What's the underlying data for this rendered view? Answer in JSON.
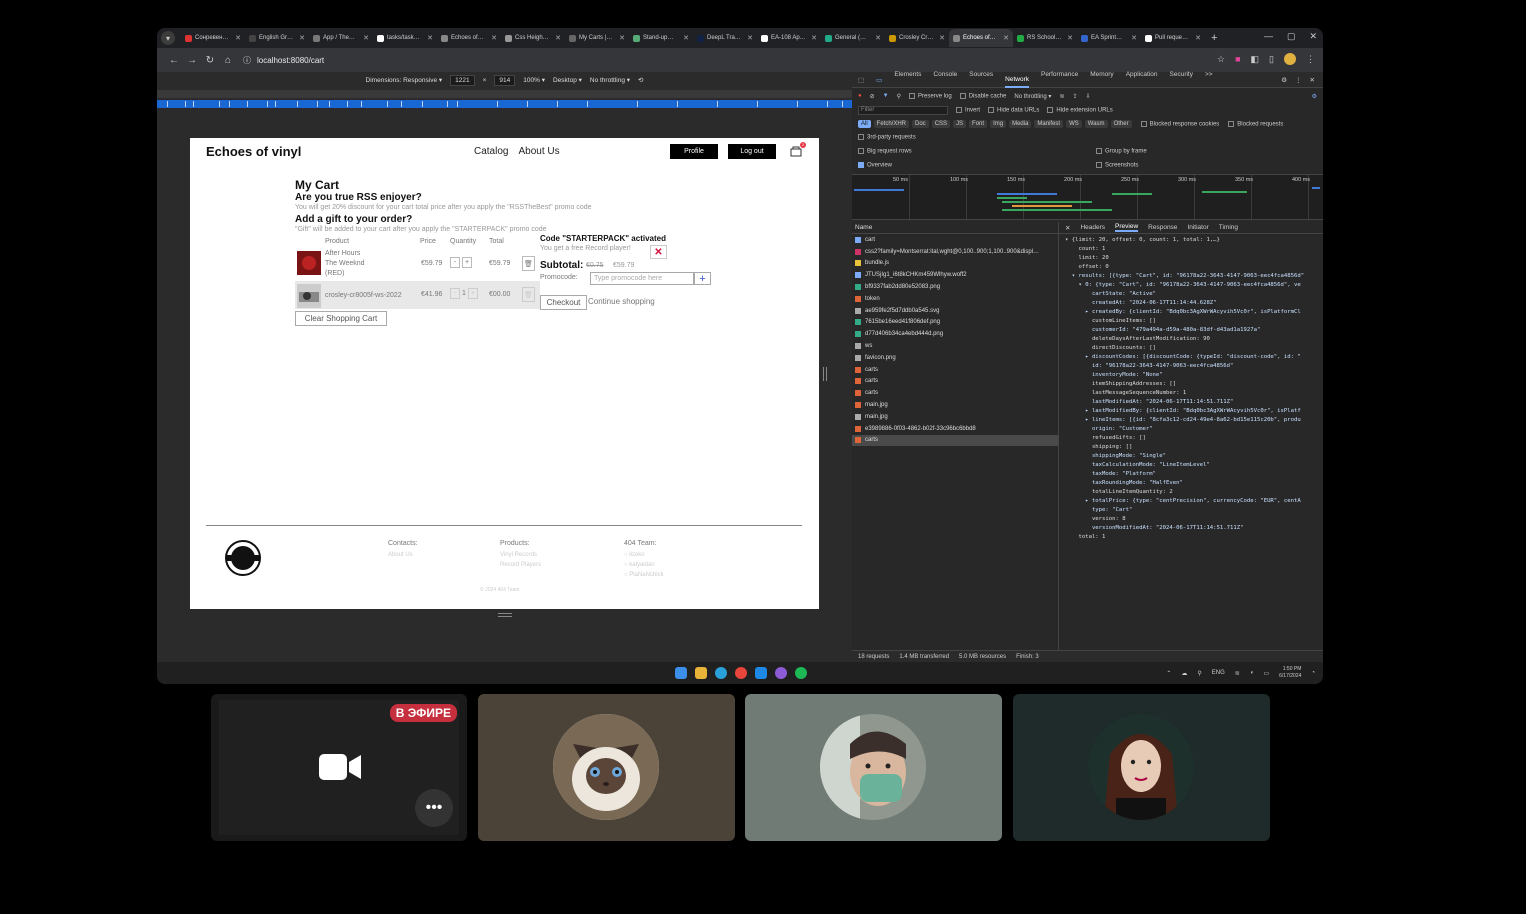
{
  "browser": {
    "tabs": [
      {
        "label": "Coнpeвен…",
        "color": "#d33"
      },
      {
        "label": "English Gr…",
        "color": "#444"
      },
      {
        "label": "App / The…",
        "color": "#777"
      },
      {
        "label": "tasks/task…",
        "color": "#fff"
      },
      {
        "label": "Echoes of…",
        "color": "#888"
      },
      {
        "label": "Css Heigh…",
        "color": "#999"
      },
      {
        "label": "My Carts |…",
        "color": "#666"
      },
      {
        "label": "Stand-up…",
        "color": "#5a7"
      },
      {
        "label": "DeepL Tra…",
        "color": "#124"
      },
      {
        "label": "EA-108 Ap…",
        "color": "#fff"
      },
      {
        "label": "General (…",
        "color": "#2a8"
      },
      {
        "label": "Crosley Cr…",
        "color": "#c90"
      },
      {
        "label": "Echoes of…",
        "color": "#888",
        "active": true
      },
      {
        "label": "RS School…",
        "color": "#2a4"
      },
      {
        "label": "EA Sprint…",
        "color": "#36c"
      },
      {
        "label": "Pull reque…",
        "color": "#fff"
      }
    ],
    "url": "localhost:8080/cart",
    "device": {
      "dimensions_label": "Dimensions: Responsive ▾",
      "width": "1221",
      "x": "×",
      "height": "914",
      "zoom": "100% ▾",
      "mode": "Desktop ▾",
      "throttle": "No throttling ▾"
    }
  },
  "site": {
    "logo": "Echoes of vinyl",
    "nav": [
      "Catalog",
      "About Us"
    ],
    "profile_btn": "Profile",
    "logout_btn": "Log out",
    "cart_count": "2",
    "cart_title": "My Cart",
    "rss_heading": "Are you true RSS enjoyer?",
    "rss_text": "You will get 20% discount for your cart total price after you apply the \"RSSTheBest\" promo code",
    "gift_heading": "Add a gift to your order?",
    "gift_text": "\"Gift\" will be added to your cart after you apply the \"STARTERPACK\" promo code",
    "columns": [
      "Product",
      "Price",
      "Quantity",
      "Total"
    ],
    "items": [
      {
        "name_lines": [
          "After Hours",
          "The Weeknd",
          "(RED)"
        ],
        "price": "€59.79",
        "qty": "1",
        "total": "€59.79"
      },
      {
        "name_lines": [
          "crosley-cr8005f-ws-2022"
        ],
        "price": "€41.96",
        "qty": "1",
        "total": "€00.00"
      }
    ],
    "code_activated": "Code \"STARTERPACK\" activated",
    "free_record": "You get a free Record player!",
    "subtotal_label": "Subtotal:",
    "old_price": "€0.75",
    "new_price": "€59.79",
    "promo_label": "Promocode:",
    "promo_placeholder": "Type promocode here",
    "checkout": "Checkout",
    "continue": "Continue shopping",
    "clear": "Clear Shopping Cart",
    "footer": {
      "contacts": "Contacts:",
      "contacts_links": [
        "About Us"
      ],
      "products": "Products:",
      "products_links": [
        "Vinyl Records",
        "Record Players"
      ],
      "team": "404 Team:",
      "team_links": [
        "lizeko",
        "kalyaidan",
        "PlaNaNchick"
      ],
      "copy": "© 2024 404 Team"
    }
  },
  "devtools": {
    "tabs": [
      "Elements",
      "Console",
      "Sources",
      "Network",
      "Performance",
      "Memory",
      "Application",
      "Security",
      ">>"
    ],
    "active_tab": "Network",
    "toolbar": {
      "preserve": "Preserve log",
      "disable_cache": "Disable cache",
      "throttle": "No throttling"
    },
    "filter_placeholder": "Filter",
    "filter_opts": [
      "Invert",
      "Hide data URLs",
      "Hide extension URLs"
    ],
    "types": [
      "All",
      "Fetch/XHR",
      "Doc",
      "CSS",
      "JS",
      "Font",
      "Img",
      "Media",
      "Manifest",
      "WS",
      "Wasm",
      "Other"
    ],
    "blocked": [
      "Blocked response cookies",
      "Blocked requests"
    ],
    "third_party": "3rd-party requests",
    "big_rows": "Big request rows",
    "group_frame": "Group by frame",
    "overview": "Overview",
    "screenshots": "Screenshots",
    "timeline_labels": [
      "50 ms",
      "100 ms",
      "150 ms",
      "200 ms",
      "250 ms",
      "300 ms",
      "350 ms",
      "400 ms"
    ],
    "name_header": "Name",
    "requests": [
      {
        "name": "cart",
        "color": "#7cacf8"
      },
      {
        "name": "css2?family=Montserrat:ital,wght@0,100..900;1,100..900&displ…",
        "color": "#c36"
      },
      {
        "name": "bundle.js",
        "color": "#e8c23a"
      },
      {
        "name": "JTUSjIg1_i6t8kCHKm459Wlhyw.woff2",
        "color": "#7cacf8"
      },
      {
        "name": "bf9337fab2dd80e52083.png",
        "color": "#3a8"
      },
      {
        "name": "token",
        "color": "#e0643a"
      },
      {
        "name": "ae959fe2f5d7ddb0a545.svg",
        "color": "#aaa"
      },
      {
        "name": "7615be16eed41f806def.png",
        "color": "#3a8"
      },
      {
        "name": "d77d406b34ca4ebd444d.png",
        "color": "#3a8"
      },
      {
        "name": "ws",
        "color": "#aaa"
      },
      {
        "name": "favicon.png",
        "color": "#aaa"
      },
      {
        "name": "carts",
        "color": "#e0643a"
      },
      {
        "name": "carts",
        "color": "#e0643a"
      },
      {
        "name": "carts",
        "color": "#e0643a"
      },
      {
        "name": "main.jpg",
        "color": "#e0643a"
      },
      {
        "name": "main.jpg",
        "color": "#aaa"
      },
      {
        "name": "e3989886-0f03-4862-b02f-33c96bc6bbd8",
        "color": "#e0643a"
      },
      {
        "name": "carts",
        "color": "#e0643a",
        "selected": true
      }
    ],
    "preview_tabs": [
      "Headers",
      "Preview",
      "Response",
      "Initiator",
      "Timing"
    ],
    "active_preview": "Preview",
    "json_lines": [
      "▾ {limit: 20, offset: 0, count: 1, total: 1,…}",
      "    count: 1",
      "    limit: 20",
      "    offset: 0",
      "  ▾ results: [{type: \"Cart\", id: \"96178a22-3643-4147-9063-eec4fca4856d\"",
      "    ▾ 0: {type: \"Cart\", id: \"96178a22-3643-4147-9063-eec4fca4856d\", ve",
      "        cartState: \"Active\"",
      "        createdAt: \"2024-06-17T11:14:44.628Z\"",
      "      ▸ createdBy: {clientId: \"Bdq0bc3AgXWrWAcyvih5Vc0r\", isPlatformCl",
      "        customLineItems: []",
      "        customerId: \"479a494a-d59a-480a-83df-d43ad1a1927a\"",
      "        deleteDaysAfterLastModification: 90",
      "        directDiscounts: []",
      "      ▸ discountCodes: [{discountCode: {typeId: \"discount-code\", id: \"",
      "        id: \"96178a22-3643-4147-9063-eec4fca4856d\"",
      "        inventoryMode: \"None\"",
      "        itemShippingAddresses: []",
      "        lastMessageSequenceNumber: 1",
      "        lastModifiedAt: \"2024-06-17T11:14:51.711Z\"",
      "      ▸ lastModifiedBy: {clientId: \"Bdq0bc3AgXWrWAcyvih5Vc0r\", isPlatf",
      "      ▸ lineItems: [{id: \"8cfa3c12-cd24-49e4-8a62-bd15e115c20b\", produ",
      "        origin: \"Customer\"",
      "        refusedGifts: []",
      "        shipping: []",
      "        shippingMode: \"Single\"",
      "        taxCalculationMode: \"LineItemLevel\"",
      "        taxMode: \"Platform\"",
      "        taxRoundingMode: \"HalfEven\"",
      "        totalLineItemQuantity: 2",
      "      ▸ totalPrice: {type: \"centPrecision\", currencyCode: \"EUR\", centA",
      "        type: \"Cart\"",
      "        version: 8",
      "        versionModifiedAt: \"2024-06-17T11:14:51.711Z\"",
      "    total: 1"
    ],
    "status": [
      "18 requests",
      "1.4 MB transferred",
      "5.0 MB resources",
      "Finish: 3"
    ]
  },
  "taskbar": {
    "lang": "ENG",
    "time": "1:50 PM",
    "date": "6/17/2024"
  },
  "call": {
    "live_label": "В ЭФИРЕ",
    "more_label": "•••"
  }
}
